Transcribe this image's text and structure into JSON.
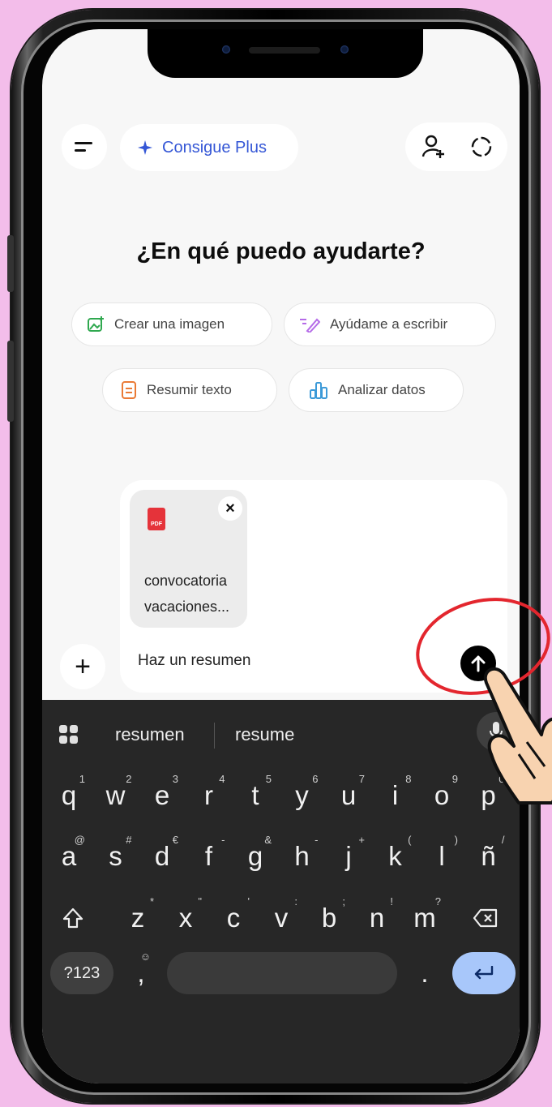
{
  "header": {
    "plus_label": "Consigue Plus"
  },
  "main": {
    "title": "¿En qué puedo ayudarte?",
    "chips": [
      {
        "label": "Crear una imagen",
        "icon": "image-icon",
        "color": "#2fa84f"
      },
      {
        "label": "Ayúdame a escribir",
        "icon": "pen-icon",
        "color": "#b56be8"
      },
      {
        "label": "Resumir texto",
        "icon": "document-icon",
        "color": "#ea7a35"
      },
      {
        "label": "Analizar datos",
        "icon": "bar-chart-icon",
        "color": "#3c9ad8"
      }
    ]
  },
  "composer": {
    "attachment_badge": "PDF",
    "attachment_name_line1": "convocatoria",
    "attachment_name_line2": "vacaciones...",
    "close_glyph": "×",
    "input_text": "Haz un resumen",
    "add_glyph": "+"
  },
  "keyboard": {
    "suggestions": [
      "resumen",
      "resume"
    ],
    "row1": [
      {
        "k": "q",
        "s": "1"
      },
      {
        "k": "w",
        "s": "2"
      },
      {
        "k": "e",
        "s": "3"
      },
      {
        "k": "r",
        "s": "4"
      },
      {
        "k": "t",
        "s": "5"
      },
      {
        "k": "y",
        "s": "6"
      },
      {
        "k": "u",
        "s": "7"
      },
      {
        "k": "i",
        "s": "8"
      },
      {
        "k": "o",
        "s": "9"
      },
      {
        "k": "p",
        "s": "0"
      }
    ],
    "row2": [
      {
        "k": "a",
        "s": "@"
      },
      {
        "k": "s",
        "s": "#"
      },
      {
        "k": "d",
        "s": "€"
      },
      {
        "k": "f",
        "s": "-"
      },
      {
        "k": "g",
        "s": "&"
      },
      {
        "k": "h",
        "s": "-"
      },
      {
        "k": "j",
        "s": "+"
      },
      {
        "k": "k",
        "s": "("
      },
      {
        "k": "l",
        "s": ")"
      },
      {
        "k": "ñ",
        "s": "/"
      }
    ],
    "row3": [
      {
        "k": "z",
        "s": "*"
      },
      {
        "k": "x",
        "s": "\""
      },
      {
        "k": "c",
        "s": "'"
      },
      {
        "k": "v",
        "s": ":"
      },
      {
        "k": "b",
        "s": ";"
      },
      {
        "k": "n",
        "s": "!"
      },
      {
        "k": "m",
        "s": "?"
      }
    ],
    "numbers_key": "?123",
    "comma_key": ",",
    "emoji_hint": "☺",
    "period_key": "."
  },
  "colors": {
    "accent": "#3557d6",
    "background": "#f3bdea",
    "highlight": "#e3262e"
  }
}
